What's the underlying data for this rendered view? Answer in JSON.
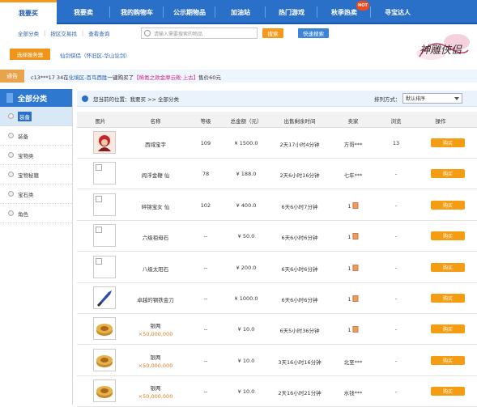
{
  "nav": {
    "tabs": [
      {
        "label": "我要买",
        "active": true
      },
      {
        "label": "我要卖",
        "active": false
      },
      {
        "label": "我的购物车",
        "active": false
      },
      {
        "label": "公示期物品",
        "active": false
      },
      {
        "label": "加油站",
        "active": false
      },
      {
        "label": "热门游戏",
        "active": false
      },
      {
        "label": "秋季热卖",
        "active": false,
        "badge": "HOT"
      },
      {
        "label": "寻宝达人",
        "active": false
      }
    ]
  },
  "subnav": {
    "links": [
      "全部分类",
      "按区交易找",
      "查看查询"
    ],
    "search_placeholder": "请输入需要搜索的物品",
    "search_button": "搜索",
    "fast_search_button": "快速搜索"
  },
  "server": {
    "button": "选择服务器",
    "current": "仙剑侠侣（怀旧区-华山论剑）"
  },
  "logo_text": "神雕侠侣",
  "ticker": {
    "label": "通告",
    "part1": "c13***17 34在",
    "part2": "化境区-百鸟西胜",
    "part3": "一键购买了",
    "part4": "【稀氪之款金摩云靴·上古】",
    "part5": "售价60元"
  },
  "sidebar": {
    "title": "全部分类",
    "items": [
      {
        "label": "装备",
        "active": true
      },
      {
        "label": "装备",
        "active": false
      },
      {
        "label": "宝物类",
        "active": false
      },
      {
        "label": "宝物秘籍",
        "active": false
      },
      {
        "label": "宝石类",
        "active": false
      },
      {
        "label": "角色",
        "active": false
      }
    ]
  },
  "location": {
    "text": "您当前的位置：我要买 >> 全部分类",
    "sort_label": "排列方式：",
    "sort_value": "默认排序"
  },
  "table": {
    "headers": [
      "图片",
      "名称",
      "等级",
      "总金额（元）",
      "出售剩余时间",
      "卖家",
      "浏览",
      "操作"
    ],
    "rows": [
      {
        "name": "西域宝字",
        "name2": "",
        "level": "109",
        "price": "¥ 1500.0",
        "time": "2天17小时4分钟",
        "seller": "方哥***",
        "views": "13",
        "thumb": "hero"
      },
      {
        "name": "阎浮金鞭 仙",
        "name2": "",
        "level": "78",
        "price": "¥ 188.0",
        "time": "2天6小时16分钟",
        "seller": "七年***",
        "views": "-",
        "thumb": "broken"
      },
      {
        "name": "碎锦宝女 仙",
        "name2": "",
        "level": "102",
        "price": "¥ 400.0",
        "time": "6天6小时7分钟",
        "seller": "1",
        "views": "-",
        "thumb": "broken"
      },
      {
        "name": "六级祖母石",
        "name2": "",
        "level": "--",
        "price": "¥ 50.0",
        "time": "6天6小时6分钟",
        "seller": "1",
        "views": "-",
        "thumb": "broken"
      },
      {
        "name": "八级太阳石",
        "name2": "",
        "level": "--",
        "price": "¥ 200.0",
        "time": "6天6小时6分钟",
        "seller": "1",
        "views": "-",
        "thumb": "broken"
      },
      {
        "name": "卓越的钢铁金刀",
        "name2": "",
        "level": "--",
        "price": "¥ 1000.0",
        "time": "6天6小时6分钟",
        "seller": "1",
        "views": "-",
        "thumb": "blade"
      },
      {
        "name": "银两",
        "name2": "×50,000,000",
        "level": "--",
        "price": "¥ 10.0",
        "time": "6天5小时36分钟",
        "seller": "1",
        "views": "-",
        "thumb": "coin"
      },
      {
        "name": "银两",
        "name2": "×50,000,000",
        "level": "--",
        "price": "¥ 10.0",
        "time": "3天16小时16分钟",
        "seller": "北至***",
        "views": "-",
        "thumb": "coin"
      },
      {
        "name": "银两",
        "name2": "×50,000,000",
        "level": "--",
        "price": "¥ 10.0",
        "time": "2天16小时21分钟",
        "seller": "水钱***",
        "views": "-",
        "thumb": "coin"
      }
    ],
    "buy_label": "购买"
  },
  "colors": {
    "nav_bg": "#2a70c9",
    "accent_orange": "#f49c12",
    "link_blue": "#2a63b3"
  }
}
